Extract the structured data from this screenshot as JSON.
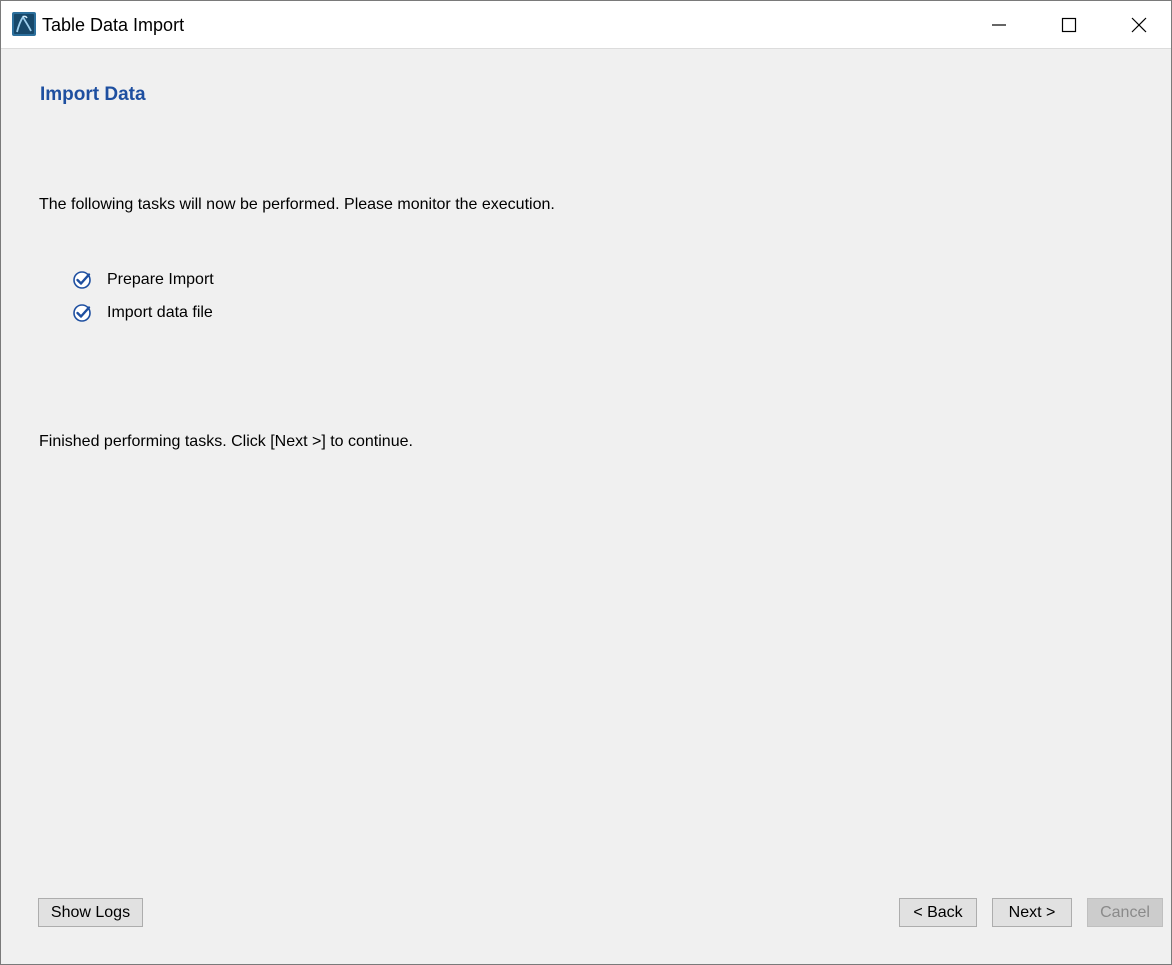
{
  "window": {
    "title": "Table Data Import",
    "icon": "mysql-workbench-icon"
  },
  "controls": {
    "minimize": "minimize-icon",
    "maximize": "maximize-icon",
    "close": "close-icon"
  },
  "page": {
    "heading": "Import Data",
    "intro": "The following tasks will now be performed. Please monitor the execution.",
    "tasks": [
      {
        "label": "Prepare Import",
        "status": "done"
      },
      {
        "label": "Import data file",
        "status": "done"
      }
    ],
    "finished": "Finished performing tasks. Click [Next >] to continue."
  },
  "buttons": {
    "show_logs": "Show Logs",
    "back": "< Back",
    "next": "Next >",
    "cancel": "Cancel"
  },
  "colors": {
    "heading": "#1e4fa0",
    "check": "#1e4fa0",
    "background": "#f0f0f0"
  }
}
